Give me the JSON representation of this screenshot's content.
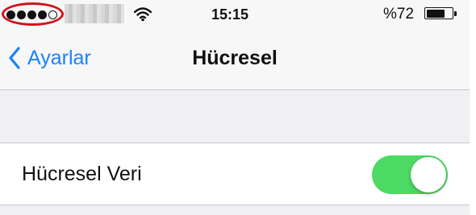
{
  "status_bar": {
    "signal_bars_filled": 4,
    "signal_bars_total": 5,
    "signal_highlight_color": "#d0121b",
    "carrier_icon": "obscured-carrier-name",
    "wifi_icon": "wifi-icon",
    "time": "15:15",
    "battery_percent_text": "%72",
    "battery_level": 0.72
  },
  "nav_bar": {
    "back_label": "Ayarlar",
    "back_icon": "chevron-left-icon",
    "title": "Hücresel",
    "accent_color": "#1a82fb"
  },
  "settings": {
    "cellular_data": {
      "label": "Hücresel Veri",
      "enabled": true,
      "toggle_on_color": "#4cd964"
    }
  }
}
